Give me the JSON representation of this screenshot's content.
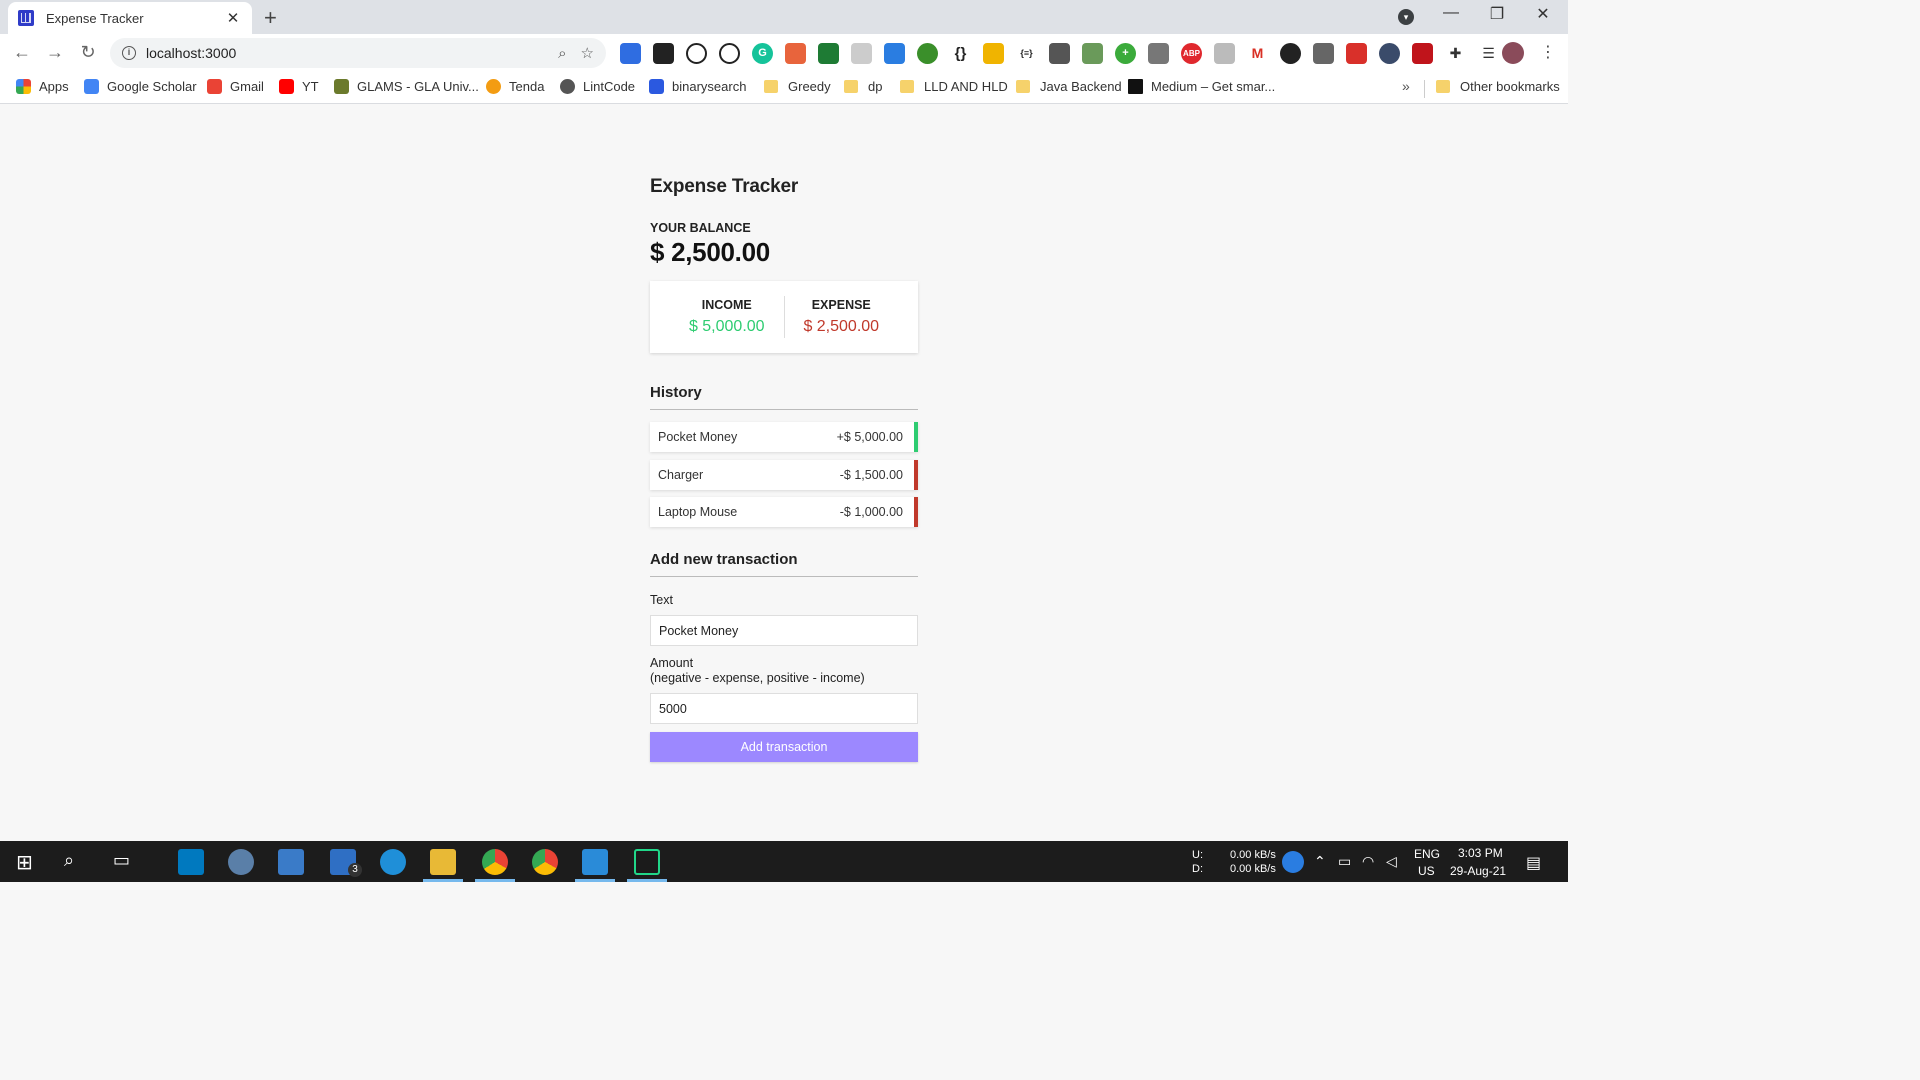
{
  "browser": {
    "tab_title": "Expense Tracker",
    "tab_close": "✕",
    "new_tab": "+",
    "url": "localhost:3000",
    "bookmarks": [
      {
        "label": "Apps",
        "color": "#4285f4"
      },
      {
        "label": "Google Scholar",
        "color": "#4285f4"
      },
      {
        "label": "Gmail",
        "color": "#ea4335"
      },
      {
        "label": "YT",
        "color": "#ff0000"
      },
      {
        "label": "GLAMS - GLA Univ...",
        "color": "#6b7a2c"
      },
      {
        "label": "Tenda",
        "color": "#f39c12"
      },
      {
        "label": "LintCode",
        "color": "#555555"
      },
      {
        "label": "binarysearch",
        "color": "#2b59e0"
      },
      {
        "label": "Greedy",
        "color": "#f6d26b"
      },
      {
        "label": "dp",
        "color": "#f6d26b"
      },
      {
        "label": "LLD AND HLD",
        "color": "#f6d26b"
      },
      {
        "label": "Java Backend",
        "color": "#f6d26b"
      },
      {
        "label": "Medium – Get smar...",
        "color": "#111111"
      },
      {
        "label": "Other bookmarks",
        "color": "#f6d26b"
      }
    ],
    "bookmarks_overflow": "»"
  },
  "app": {
    "title": "Expense Tracker",
    "balance_label": "Your Balance",
    "balance": "$ 2,500.00",
    "income_label": "Income",
    "income": "$ 5,000.00",
    "expense_label": "Expense",
    "expense": "$ 2,500.00",
    "history_title": "History",
    "transactions": [
      {
        "text": "Pocket Money",
        "amount": "+$ 5,000.00",
        "type": "plus"
      },
      {
        "text": "Charger",
        "amount": "-$ 1,500.00",
        "type": "minus"
      },
      {
        "text": "Laptop Mouse",
        "amount": "-$ 1,000.00",
        "type": "minus"
      }
    ],
    "add_title": "Add new transaction",
    "text_label": "Text",
    "text_value": "Pocket Money",
    "amount_label": "Amount",
    "amount_hint": "(negative - expense, positive - income)",
    "amount_value": "5000",
    "add_button": "Add transaction",
    "colors": {
      "income": "#2ecc71",
      "expense": "#c0392b",
      "button": "#9c88ff"
    }
  },
  "taskbar": {
    "net_upload_label": "U:",
    "net_download_label": "D:",
    "net_upload": "0.00 kB/s",
    "net_download": "0.00 kB/s",
    "lang": "ENG",
    "region": "US",
    "time": "3:03 PM",
    "date": "29-Aug-21",
    "mail_badge": "3"
  }
}
